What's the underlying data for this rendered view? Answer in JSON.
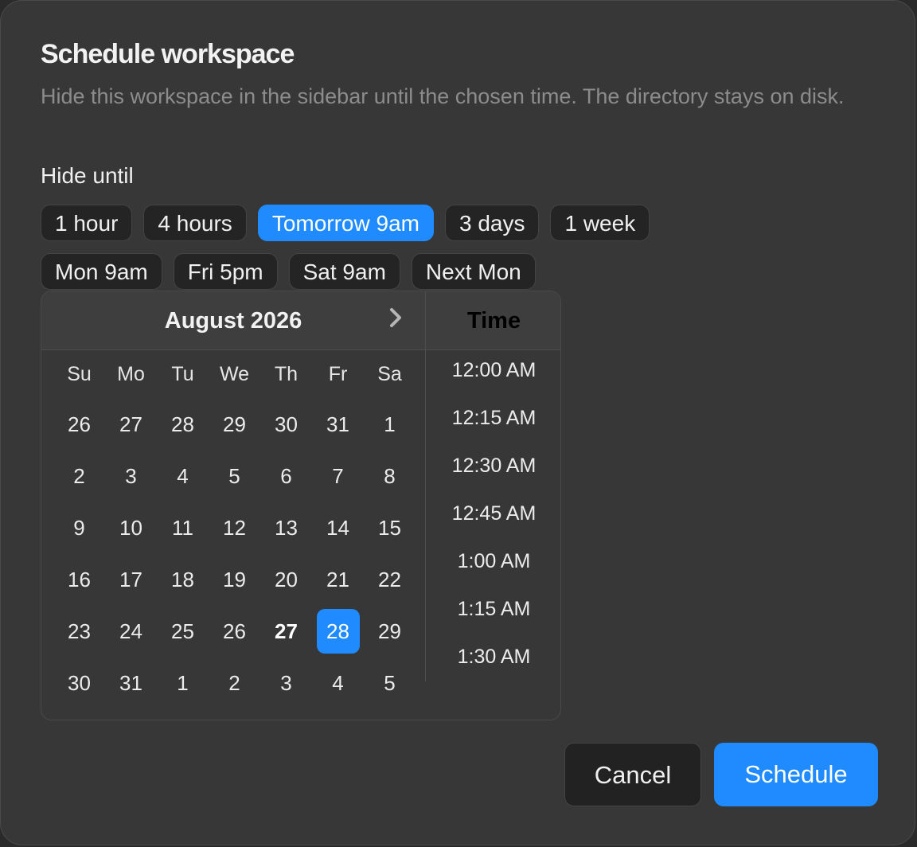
{
  "dialog": {
    "title": "Schedule workspace",
    "description": "Hide this workspace in the sidebar until the chosen time. The directory stays on disk.",
    "section_label": "Hide until"
  },
  "presets": {
    "row1": [
      "1 hour",
      "4 hours",
      "Tomorrow 9am",
      "3 days",
      "1 week"
    ],
    "row2": [
      "Mon 9am",
      "Fri 5pm",
      "Sat 9am",
      "Next Mon"
    ],
    "selected": "Tomorrow 9am"
  },
  "calendar": {
    "month_label": "August 2026",
    "next_icon": "chevron-right-icon",
    "weekdays": [
      "Su",
      "Mo",
      "Tu",
      "We",
      "Th",
      "Fr",
      "Sa"
    ],
    "days": [
      "26",
      "27",
      "28",
      "29",
      "30",
      "31",
      "1",
      "2",
      "3",
      "4",
      "5",
      "6",
      "7",
      "8",
      "9",
      "10",
      "11",
      "12",
      "13",
      "14",
      "15",
      "16",
      "17",
      "18",
      "19",
      "20",
      "21",
      "22",
      "23",
      "24",
      "25",
      "26",
      "27",
      "28",
      "29",
      "30",
      "31",
      "1",
      "2",
      "3",
      "4",
      "5"
    ],
    "today": "27",
    "selected": "28"
  },
  "time": {
    "header": "Time",
    "options": [
      "12:00 AM",
      "12:15 AM",
      "12:30 AM",
      "12:45 AM",
      "1:00 AM",
      "1:15 AM",
      "1:30 AM"
    ]
  },
  "actions": {
    "cancel_label": "Cancel",
    "schedule_label": "Schedule"
  },
  "colors": {
    "accent": "#1f8bff",
    "dialog_bg": "#373737",
    "chip_bg": "#242424"
  }
}
